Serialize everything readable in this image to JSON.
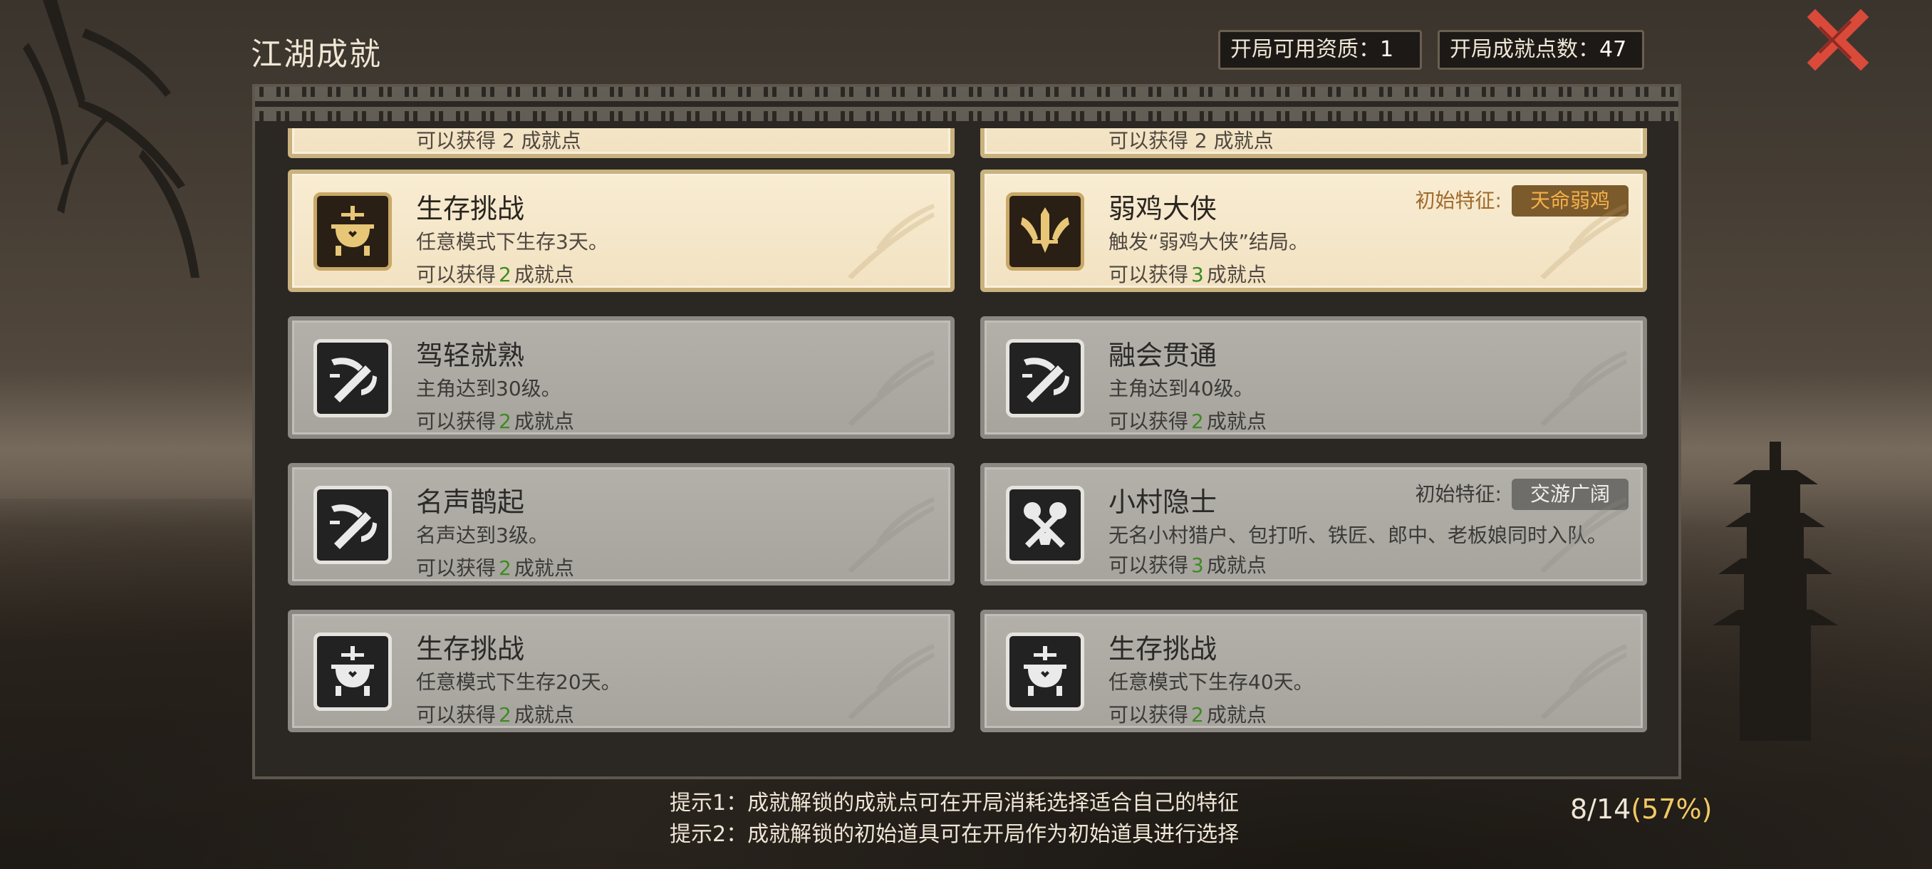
{
  "header": {
    "title": "江湖成就",
    "stats": [
      {
        "label": "开局可用资质：",
        "value": "1"
      },
      {
        "label": "开局成就点数：",
        "value": "47"
      }
    ]
  },
  "partial_row": {
    "left": "可以获得 2 成就点",
    "right": "可以获得 2 成就点"
  },
  "reward_prefix": "可以获得",
  "reward_suffix": "成就点",
  "achievements": [
    {
      "title": "生存挑战",
      "desc": "任意模式下生存3天。",
      "points": "2",
      "state": "unlocked",
      "icon": "cauldron-icon"
    },
    {
      "title": "弱鸡大侠",
      "desc": "触发“弱鸡大侠”结局。",
      "points": "3",
      "state": "unlocked",
      "icon": "winged-sword-icon",
      "trait_label": "初始特征:",
      "trait": "天命弱鸡"
    },
    {
      "title": "驾轻就熟",
      "desc": "主角达到30级。",
      "points": "2",
      "state": "locked",
      "icon": "sword-scroll-icon"
    },
    {
      "title": "融会贯通",
      "desc": "主角达到40级。",
      "points": "2",
      "state": "locked",
      "icon": "sword-scroll-icon"
    },
    {
      "title": "名声鹊起",
      "desc": "名声达到3级。",
      "points": "2",
      "state": "locked",
      "icon": "sword-scroll-icon"
    },
    {
      "title": "小村隐士",
      "desc": "无名小村猎户、包打听、铁匠、郎中、老板娘同时入队。",
      "points": "3",
      "state": "locked",
      "icon": "crossed-tools-icon",
      "trait_label": "初始特征:",
      "trait": "交游广阔"
    },
    {
      "title": "生存挑战",
      "desc": "任意模式下生存20天。",
      "points": "2",
      "state": "locked",
      "icon": "cauldron-icon"
    },
    {
      "title": "生存挑战",
      "desc": "任意模式下生存40天。",
      "points": "2",
      "state": "locked",
      "icon": "cauldron-icon"
    }
  ],
  "tips": [
    "提示1：成就解锁的成就点可在开局消耗选择适合自己的特征",
    "提示2：成就解锁的初始道具可在开局作为初始道具进行选择"
  ],
  "progress": {
    "count": "8/14",
    "percent": "(57%)"
  },
  "colors": {
    "accent_green": "#3d8b22",
    "gold": "#f2c964",
    "close_red": "#d94a3a"
  }
}
